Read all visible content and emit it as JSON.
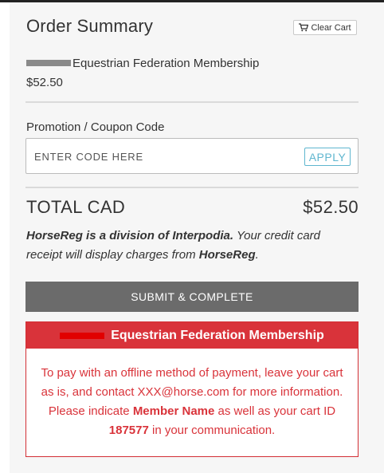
{
  "summary": {
    "title": "Order Summary",
    "clear_cart_label": "Clear Cart",
    "item": {
      "name": "Equestrian Federation Membership",
      "price": "$52.50"
    }
  },
  "promo": {
    "label": "Promotion / Coupon Code",
    "placeholder": "ENTER CODE HERE",
    "apply_label": "APPLY"
  },
  "total": {
    "label": "TOTAL CAD",
    "value": "$52.50"
  },
  "notice": {
    "bold_part": "HorseReg is a division of Interpodia.",
    "text_1": " Your credit card receipt will display charges from ",
    "brand": "HorseReg",
    "text_2": "."
  },
  "submit": {
    "label": "SUBMIT & COMPLETE"
  },
  "offline": {
    "header": "Equestrian Federation Membership",
    "text_1": "To pay with an offline method of payment, leave your cart as is, and contact XXX@horse.com for more information. Please indicate ",
    "member_name": "Member Name",
    "text_2": " as well as your cart ID ",
    "cart_id": "187577",
    "text_3": " in your communication."
  },
  "colors": {
    "accent_red": "#d9333a",
    "apply_blue": "#5fb6cf",
    "submit_gray": "#6b6b6b"
  },
  "icons": {
    "cart": "shopping-cart-icon"
  }
}
